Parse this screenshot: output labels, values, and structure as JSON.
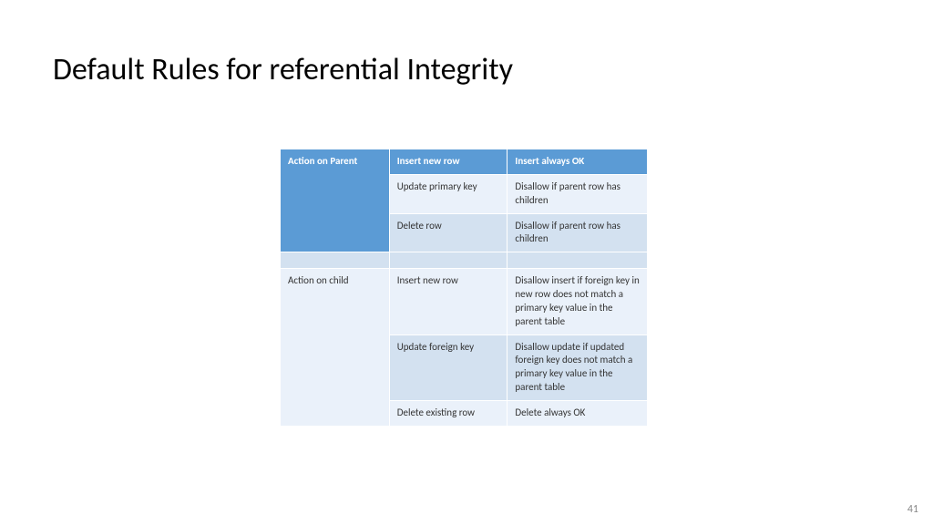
{
  "slide": {
    "title": "Default Rules for referential Integrity",
    "page_number": "41"
  },
  "table": {
    "parent_header": "Action on Parent",
    "col_action_header": "Insert new row",
    "col_rule_header": "Insert always OK",
    "parent_rows": [
      {
        "action": "Update primary key",
        "rule": "Disallow  if parent row has children"
      },
      {
        "action": "Delete row",
        "rule": "Disallow  if parent row has children"
      }
    ],
    "child_header": "Action on child",
    "child_rows": [
      {
        "action": "Insert new row",
        "rule": "Disallow insert if  foreign key in new row does not match a primary key value in the parent table"
      },
      {
        "action": "Update foreign key",
        "rule": "Disallow update if updated foreign key does not match a primary key value in the parent table"
      },
      {
        "action": "Delete existing row",
        "rule": "Delete always OK"
      }
    ]
  }
}
